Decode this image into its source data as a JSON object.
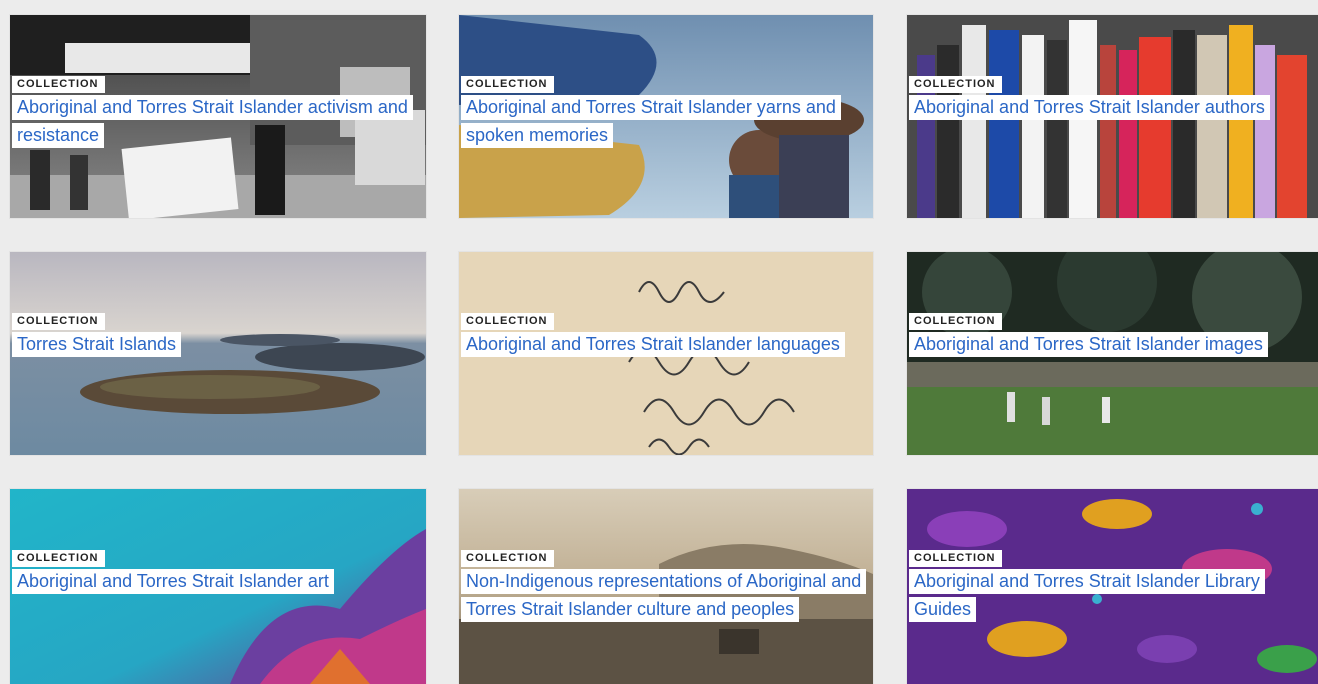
{
  "cards": [
    {
      "badge": "COLLECTION",
      "title": "Aboriginal and Torres Strait Islander activism and resistance",
      "image": "black-and-white protest march photo with placards"
    },
    {
      "badge": "COLLECTION",
      "title": "Aboriginal and Torres Strait Islander yarns and spoken memories",
      "image": "child and adult beside a boat under blue sky"
    },
    {
      "badge": "COLLECTION",
      "title": "Aboriginal and Torres Strait Islander authors",
      "image": "row of book spines on a shelf"
    },
    {
      "badge": "COLLECTION",
      "title": "Torres Strait Islands",
      "image": "aerial view of islands in the sea"
    },
    {
      "badge": "COLLECTION",
      "title": "Aboriginal and Torres Strait Islander languages",
      "image": "handwritten words on old paper"
    },
    {
      "badge": "COLLECTION",
      "title": "Aboriginal and Torres Strait Islander images",
      "image": "people gathered on a grassy field under trees"
    },
    {
      "badge": "COLLECTION",
      "title": "Aboriginal and Torres Strait Islander art",
      "image": "turquoise and purple artwork"
    },
    {
      "badge": "COLLECTION",
      "title": "Non-Indigenous representations of Aboriginal and Torres Strait Islander culture and peoples",
      "image": "sepia landscape photograph with mountains"
    },
    {
      "badge": "COLLECTION",
      "title": "Aboriginal and Torres Strait Islander Library Guides",
      "image": "purple dotted pattern artwork"
    }
  ],
  "colors": {
    "link": "#2b67c6",
    "badge_bg": "#ffffff",
    "page_bg": "#ececec"
  }
}
